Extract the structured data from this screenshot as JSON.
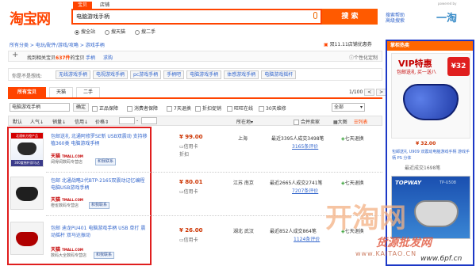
{
  "header": {
    "logo": "淘宝网",
    "tabs": [
      "宝贝",
      "店铺"
    ],
    "search_value": "电脑游戏手柄",
    "search_button": "搜 索",
    "options": [
      "搜全站",
      "搜天猫",
      "搜二手"
    ],
    "advanced_links": [
      "搜索帮助",
      "高级搜索"
    ],
    "powered_by": "powered by",
    "corner_logo": "一淘"
  },
  "breadcrumb": {
    "items": [
      "所有分类",
      "电玩/配件/游戏/攻略",
      "游戏手柄"
    ],
    "promo": "双11.11店铺优惠券",
    "filter_label": "找到相关宝贝",
    "count": "637件",
    "count_suffix": "的宝贝",
    "subfilters": [
      "手柄",
      "求购"
    ],
    "personal": "个性化定制"
  },
  "related": {
    "label": "你是不是想找:",
    "items": [
      "无线游戏手柄",
      "电视游戏手柄",
      "pc游戏手柄",
      "手柄吧",
      "电脑游戏手柄",
      "体感游戏手柄",
      "电脑游戏摇杆"
    ]
  },
  "tabs": {
    "items": [
      "所有宝贝",
      "天猫",
      "二手"
    ],
    "page": "1/100"
  },
  "filters": {
    "keyword": "电脑游戏手柄",
    "confirm": "确定",
    "checks": [
      "正品保障",
      "消费者保障",
      "7天退换",
      "折扣促销",
      "旺旺在线",
      "30天维修"
    ],
    "sort_select": "全部",
    "sort_items": [
      "默认",
      "人气",
      "销量",
      "信用",
      "价格"
    ],
    "price_sep": "-",
    "location": "所在地",
    "location_items": [
      "合并卖家",
      "大图",
      "列表"
    ]
  },
  "products": [
    {
      "badge": "北通新方橙产品",
      "thumb_caption": "360度摇杆双马达",
      "title": "包邮送礼 北通阿修罗SE新 USB双震动 支持移植360类 电脑游戏手柄",
      "shop_brand": "天猫",
      "shop_url": "TMALL.COM",
      "shop_name": "阔得阅数码专营店",
      "chat": "和我联系",
      "price": "¥ 99.00",
      "price_note": "信用卡",
      "price_note2": "折扣",
      "location": "上海",
      "sales": "最近3395人成交3498笔",
      "reviews": "3165条评价",
      "service": "七天退换"
    },
    {
      "badge": "",
      "thumb_caption": "",
      "title": "包邮 北通战略2代BTP-2165双震动记忆编程电脑USB游戏手柄",
      "shop_brand": "天猫",
      "shop_url": "TMALL.COM",
      "shop_name": "橙雀数码专营店",
      "chat": "和我联系",
      "price": "¥ 80.01",
      "price_note": "信用卡",
      "price_note2": "",
      "location": "江苏 南京",
      "sales": "最近2665人成交2741笔",
      "reviews": "7207条评价",
      "service": "七天退换"
    },
    {
      "badge": "",
      "thumb_caption": "",
      "title": "包邮 迪龙PU401 电脑游戏手柄 USB 单打 震动摇杆 双马达振动",
      "shop_brand": "天猫",
      "shop_url": "TMALL.COM",
      "shop_name": "数码大全数码专营店",
      "chat": "和我联系",
      "price": "¥ 26.00",
      "price_note": "信用卡",
      "price_note2": "",
      "location": "湖北 武汉",
      "sales": "最近852人成交864笔",
      "reviews": "1124条评价",
      "service": "七天退换"
    }
  ],
  "sidebar": {
    "heading": "掌柜热卖",
    "ad_title": "VIP特惠",
    "ad_sub": "包邮送礼 买一送八",
    "ad_price_tag": "¥32",
    "price": "¥ 32.00",
    "title": "包邮送礼 U909 双震动电脑游戏手柄 游戏手柄 PS 分体",
    "sales": "最近成交1698笔",
    "brand": "TOPWAY",
    "brand_model": "TP-U508"
  },
  "watermark": {
    "big": "开淘网",
    "sub": "货源批发网",
    "url": "www.KAITAO.CN",
    "small": "www.6pf.cn"
  },
  "colors": {
    "accent": "#ff4400",
    "link": "#3366cc",
    "price": "#cc3300",
    "red_box": "#e01e1e",
    "blue_box": "#1c38c6"
  }
}
